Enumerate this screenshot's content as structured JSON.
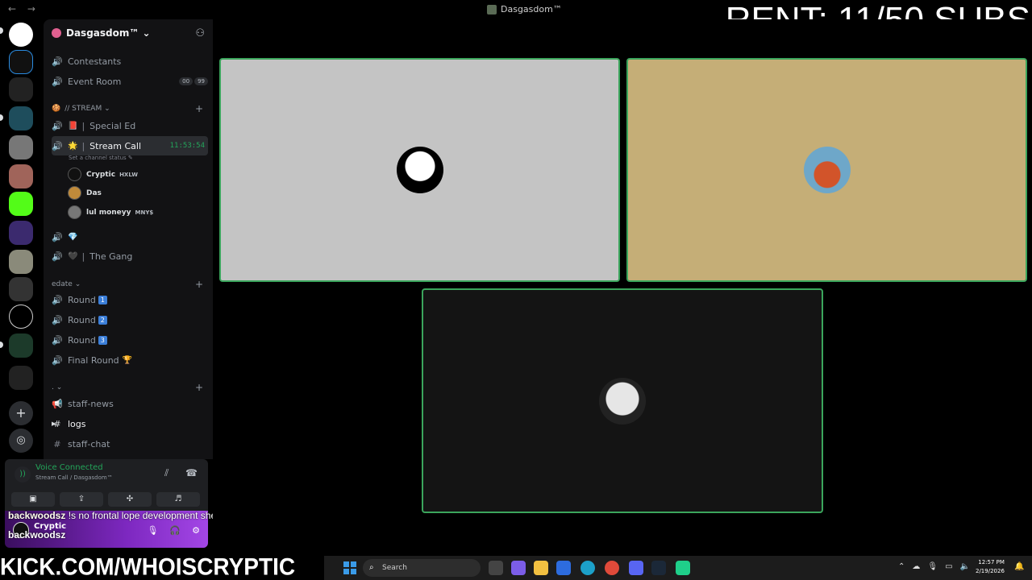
{
  "window": {
    "nav_back": "←",
    "nav_forward": "→",
    "title": "Dasgasdom™"
  },
  "overlay": {
    "rent_text": "RENT: 11/50 SUBS",
    "kick_url": "KICK.COM/WHOISCRYPTIC"
  },
  "server": {
    "name": "Dasgasdom™ ⌄"
  },
  "channels": {
    "contestants": "Contestants",
    "event_room": "Event Room",
    "event_room_badges": [
      "00",
      "99"
    ],
    "stream_category": "// STREAM ⌄",
    "special_ed": "Special Ed",
    "stream_call": "Stream Call",
    "stream_call_timer": "11:53:54",
    "channel_status": "Set a channel status ✎",
    "voice_users": [
      {
        "name": "Cryptic",
        "tag": "HXLW"
      },
      {
        "name": "Das",
        "tag": ""
      },
      {
        "name": "lul moneyy",
        "tag": "MNY$"
      }
    ],
    "gem_channel_emoji": "💎",
    "the_gang": "The Gang",
    "edate_category": "edate ⌄",
    "round": "Round",
    "round_numbers": [
      "1",
      "2",
      "3"
    ],
    "final_round": "Final Round",
    "blank_category": ". ⌄",
    "staff_news": "staff-news",
    "logs": "logs",
    "staff_chat": "staff-chat"
  },
  "voice_panel": {
    "status": "Voice Connected",
    "location": "Stream Call / Dasgasdom™"
  },
  "user_panel": {
    "name": "Cryptic"
  },
  "chat": {
    "author": "backwoodsz",
    "message": "!s no frontal lope development she has to be retarded but sexually active",
    "author2": "backwoodsz"
  },
  "taskbar": {
    "search_placeholder": "Search",
    "time": "12:57 PM",
    "date": "2/19/2026"
  },
  "colors": {
    "speaking_border": "#3ba55c",
    "tile1_bg": "#c4c4c4",
    "tile2_bg": "#c5ae77",
    "tile3_bg": "#141414",
    "voice_green": "#23a55a"
  }
}
